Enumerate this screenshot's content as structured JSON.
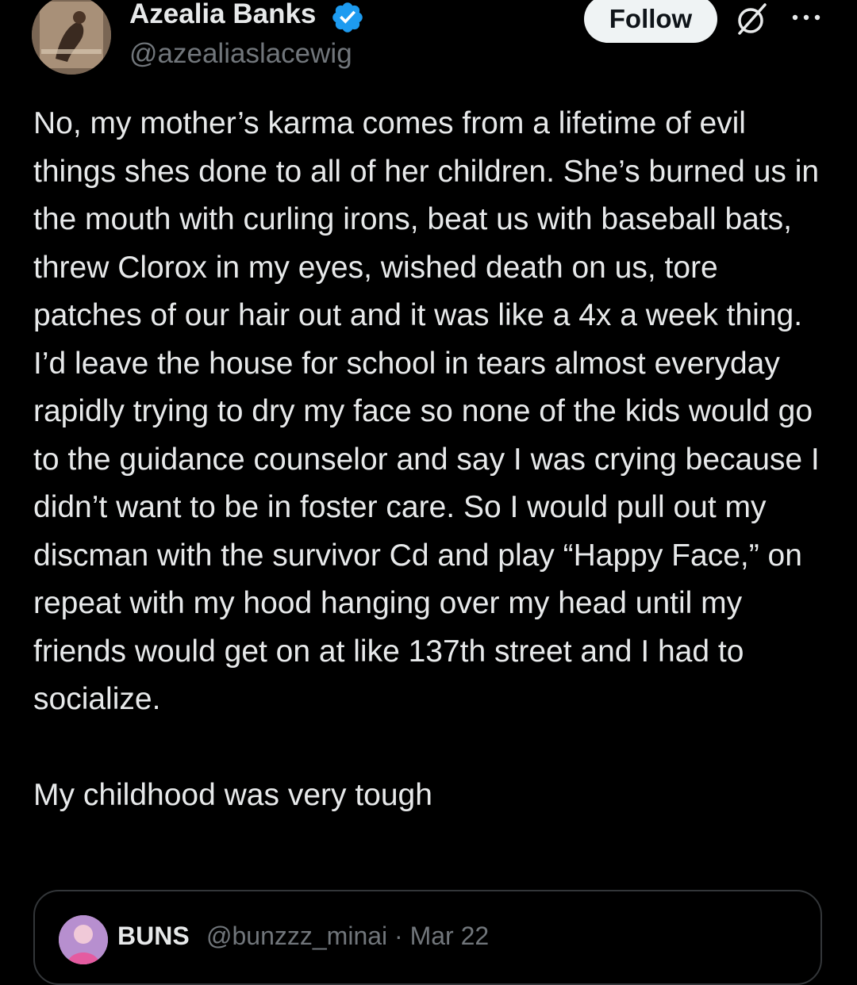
{
  "author": {
    "display_name": "Azealia Banks",
    "handle": "@azealiaslacewig",
    "verified": true,
    "verified_color": "#1d9bf0"
  },
  "actions": {
    "follow_label": "Follow",
    "grok_icon": "grok-icon",
    "more_icon": "more-icon"
  },
  "tweet": {
    "paragraph_1": "No, my mother’s karma comes from a lifetime of evil things shes done to all of her children. She’s burned us in the mouth with curling irons, beat us with baseball bats, threw Clorox in my eyes, wished death on us, tore patches of our hair out and it was like a 4x a week thing. I’d leave the house for school in tears almost everyday rapidly trying to dry my face so none of the kids would go to the guidance counselor and say I was crying because I didn’t want to be in foster care. So I would pull out my discman with the survivor Cd and play “Happy Face,” on repeat with my hood hanging over my head until my friends would get on at like 137th street and I had to socialize.",
    "paragraph_2": "My childhood was very tough"
  },
  "quoted_tweet": {
    "name": "BUNS",
    "handle_and_date": "@bunzzz_minai · Mar 22"
  },
  "colors": {
    "background": "#000000",
    "text_primary": "#e7e9ea",
    "text_secondary": "#71767b",
    "follow_bg": "#eff3f4",
    "border": "#333639"
  }
}
